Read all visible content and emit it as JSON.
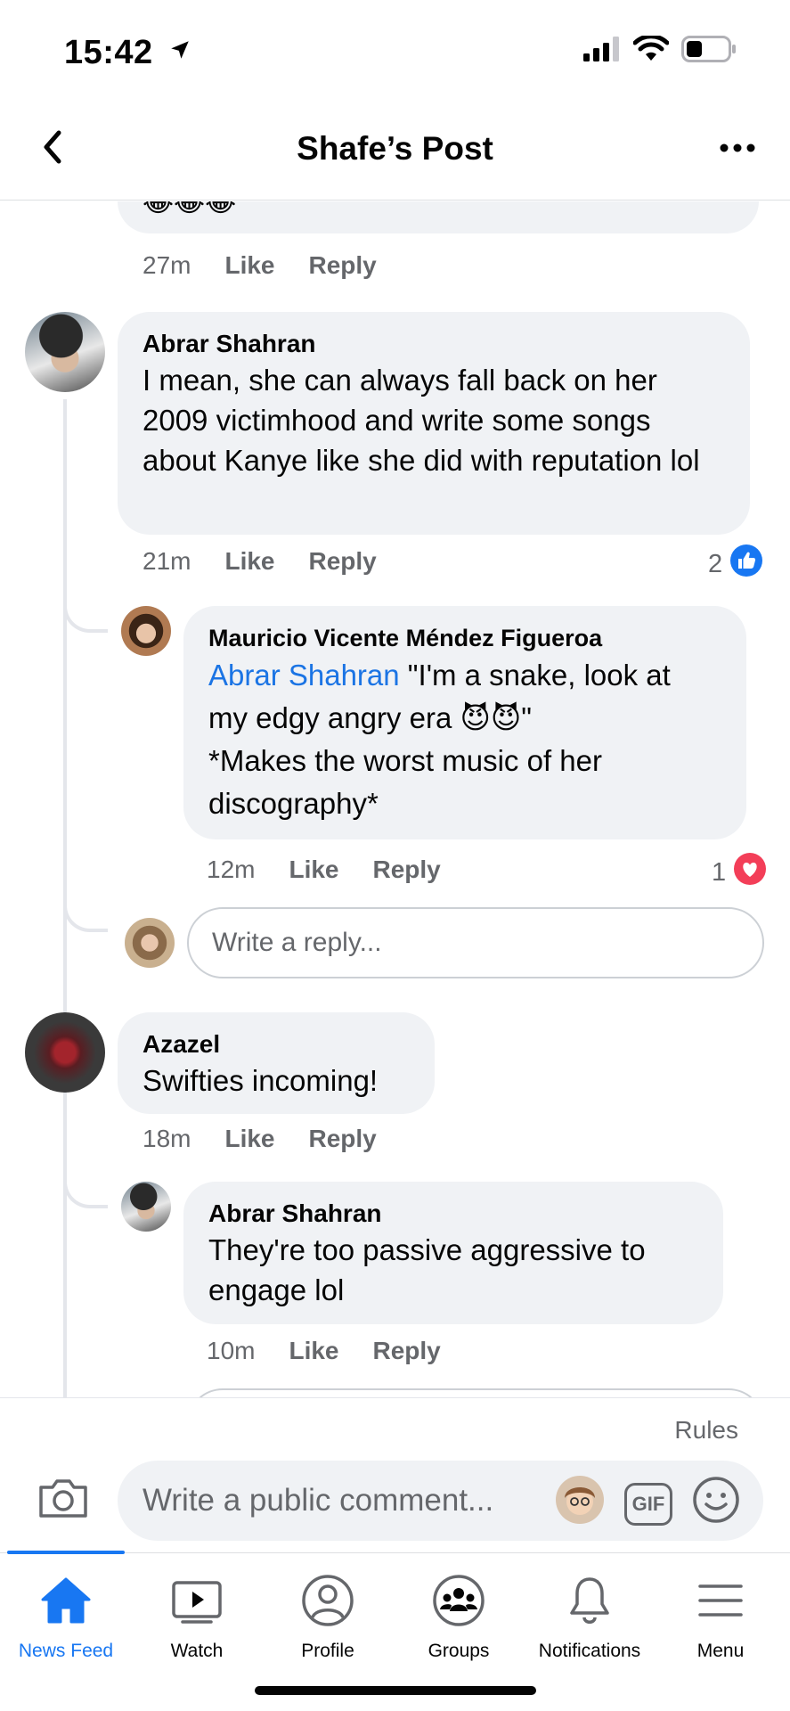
{
  "status_bar": {
    "time": "15:42"
  },
  "header": {
    "title": "Shafe’s Post"
  },
  "comments": {
    "first": {
      "emojis": "😂😂😂",
      "time": "27m",
      "like": "Like",
      "reply": "Reply"
    },
    "abrar_1": {
      "name": "Abrar Shahran",
      "text": "I mean, she can always fall back on her 2009 victimhood and write some songs about Kanye like she did with reputation lol",
      "time": "21m",
      "like": "Like",
      "reply": "Reply",
      "reaction_count": "2"
    },
    "mauricio": {
      "name": "Mauricio Vicente Méndez Figueroa",
      "mention": "Abrar Shahran",
      "text_line1": " \"I'm a snake, look at",
      "text_line2": "my edgy angry era 😈😈\"",
      "text_line3": "*Makes the worst music of her discography*",
      "time": "12m",
      "like": "Like",
      "reply": "Reply",
      "reaction_count": "1"
    },
    "reply_placeholder": "Write a reply...",
    "azazel": {
      "name": "Azazel",
      "text": "Swifties incoming!",
      "time": "18m",
      "like": "Like",
      "reply": "Reply"
    },
    "abrar_2": {
      "name": "Abrar Shahran",
      "text": "They're too passive aggressive to engage lol",
      "time": "10m",
      "like": "Like",
      "reply": "Reply"
    }
  },
  "composer": {
    "rules": "Rules",
    "placeholder": "Write a public comment...",
    "gif": "GIF"
  },
  "tabbar": {
    "tabs": [
      {
        "label": "News Feed",
        "icon": "home-icon",
        "active": true
      },
      {
        "label": "Watch",
        "icon": "watch-icon"
      },
      {
        "label": "Profile",
        "icon": "profile-icon"
      },
      {
        "label": "Groups",
        "icon": "groups-icon"
      },
      {
        "label": "Notifications",
        "icon": "bell-icon"
      },
      {
        "label": "Menu",
        "icon": "menu-icon"
      }
    ]
  },
  "colors": {
    "accent": "#1877f2",
    "bubble": "#f0f2f5",
    "secondary_text": "#65676b",
    "love": "#f33e58"
  }
}
